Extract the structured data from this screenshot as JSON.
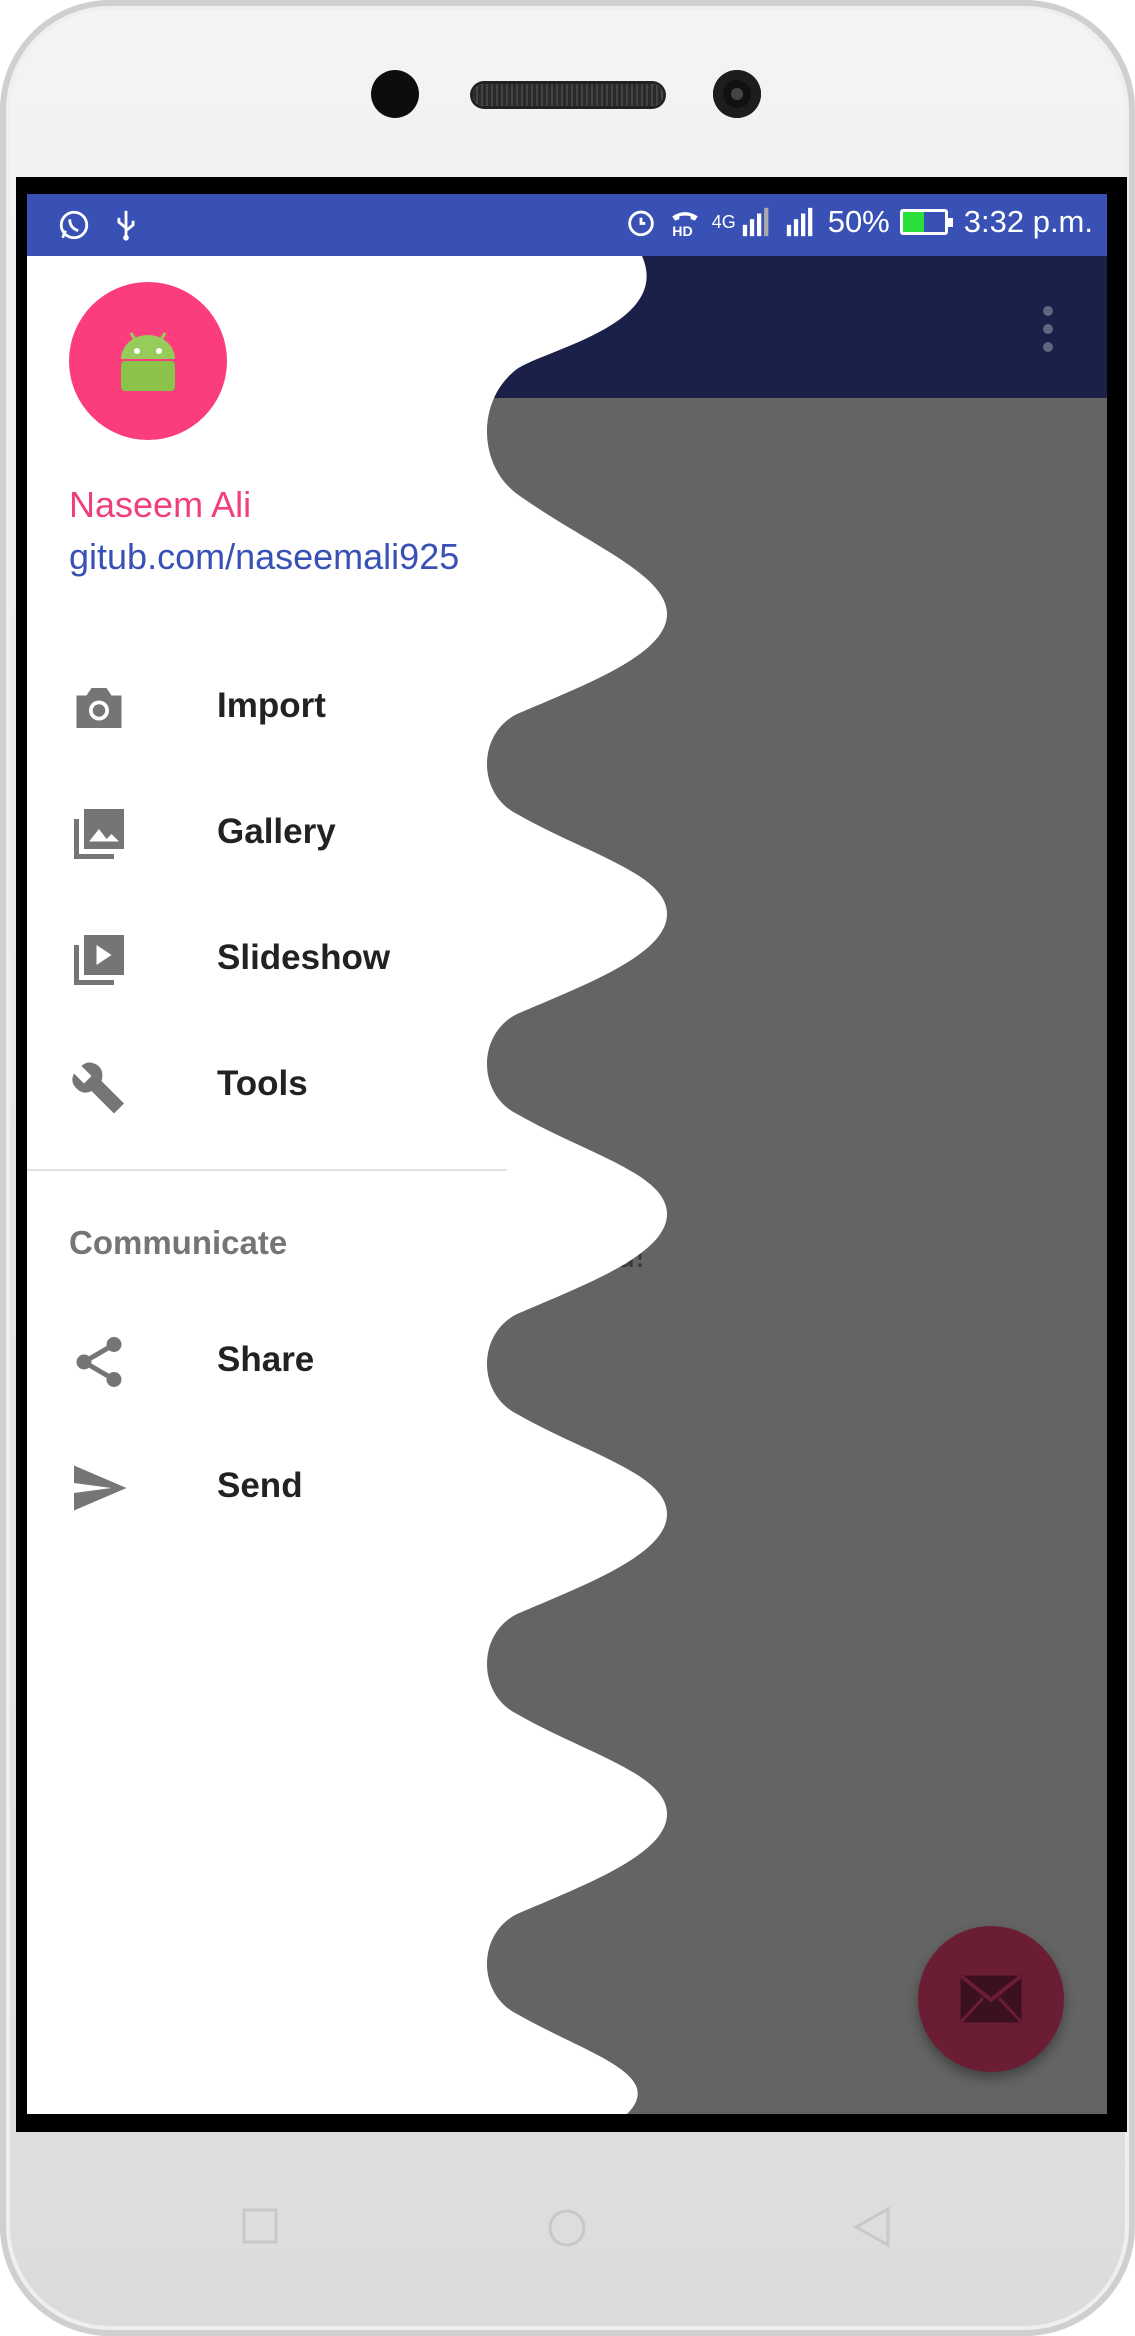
{
  "status_bar": {
    "signal_label": "4G",
    "battery_percent": "50%",
    "battery_level": 0.5,
    "time": "3:32 p.m.",
    "icons": [
      "whatsapp-icon",
      "usb-icon",
      "alarm-icon",
      "hd-call-icon",
      "signal-icon",
      "battery-icon"
    ]
  },
  "drawer": {
    "user_name": "Naseem Ali",
    "user_link": "gitub.com/naseemali925",
    "items": [
      {
        "label": "Import",
        "icon": "camera-icon"
      },
      {
        "label": "Gallery",
        "icon": "gallery-icon"
      },
      {
        "label": "Slideshow",
        "icon": "slideshow-icon"
      },
      {
        "label": "Tools",
        "icon": "wrench-icon"
      }
    ],
    "section_label": "Communicate",
    "section_items": [
      {
        "label": "Share",
        "icon": "share-icon"
      },
      {
        "label": "Send",
        "icon": "send-icon"
      }
    ]
  },
  "background": {
    "partial_text": "ld!"
  },
  "colors": {
    "status_bar": "#3951b5",
    "app_bar": "#1a2047",
    "scrim": "#646464",
    "accent_pink": "#fb3d7e",
    "link_blue": "#3951b5",
    "fab": "#6b1d34"
  }
}
